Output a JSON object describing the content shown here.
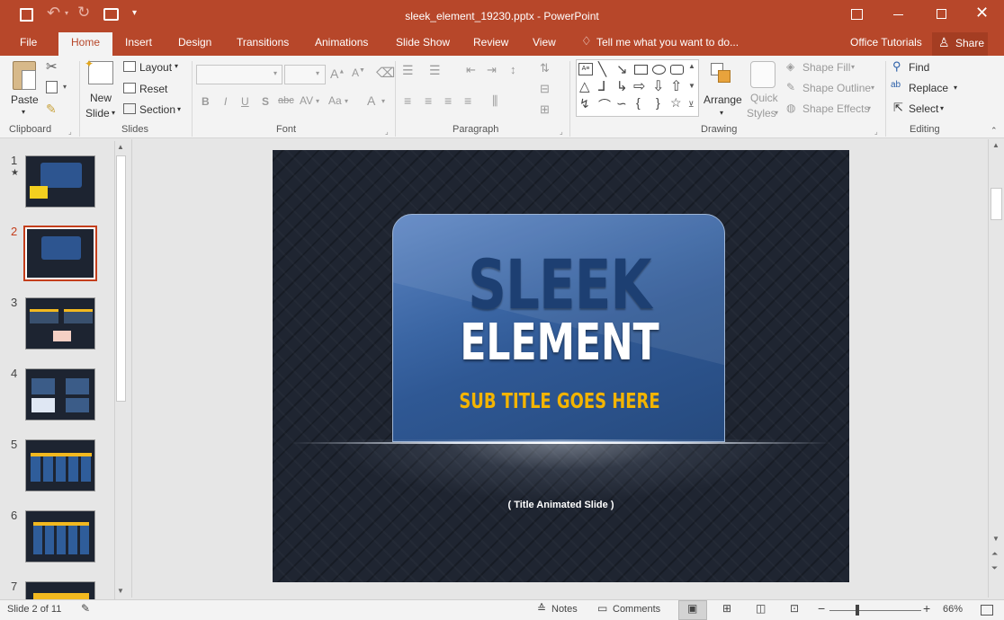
{
  "window": {
    "title": "sleek_element_19230.pptx - PowerPoint"
  },
  "ribbon_tabs": [
    "File",
    "Home",
    "Insert",
    "Design",
    "Transitions",
    "Animations",
    "Slide Show",
    "Review",
    "View"
  ],
  "tell_me": "Tell me what you want to do...",
  "office_tutorials": "Office Tutorials",
  "share": "Share",
  "clipboard": {
    "paste": "Paste",
    "group": "Clipboard"
  },
  "slides_group": {
    "new_slide_1": "New",
    "new_slide_2": "Slide",
    "layout": "Layout",
    "reset": "Reset",
    "section": "Section",
    "group": "Slides"
  },
  "font_group": {
    "group": "Font",
    "bold": "B",
    "italic": "I",
    "underline": "U",
    "shadow": "S",
    "strike": "abc",
    "spacing": "AV",
    "case": "Aa",
    "color": "A"
  },
  "paragraph_group": {
    "group": "Paragraph"
  },
  "drawing_group": {
    "arrange": "Arrange",
    "quick_1": "Quick",
    "quick_2": "Styles",
    "shape_fill": "Shape Fill",
    "shape_outline": "Shape Outline",
    "shape_effects": "Shape Effects",
    "group": "Drawing"
  },
  "editing_group": {
    "find": "Find",
    "replace": "Replace",
    "select": "Select",
    "group": "Editing"
  },
  "thumbnails": [
    {
      "num": "1",
      "star": "★"
    },
    {
      "num": "2"
    },
    {
      "num": "3"
    },
    {
      "num": "4"
    },
    {
      "num": "5"
    },
    {
      "num": "6"
    },
    {
      "num": "7"
    }
  ],
  "slide": {
    "title_1": "SLEEK",
    "title_2": "ELEMENT",
    "subtitle": "SUB TITLE GOES HERE",
    "caption": "( Title Animated Slide )"
  },
  "status": {
    "slide_of": "Slide 2 of 11",
    "notes": "Notes",
    "comments": "Comments",
    "zoom": "66%"
  },
  "colors": {
    "accent": "#b7472a",
    "selected_border": "#c43e1c",
    "subtitle": "#f3b400"
  }
}
